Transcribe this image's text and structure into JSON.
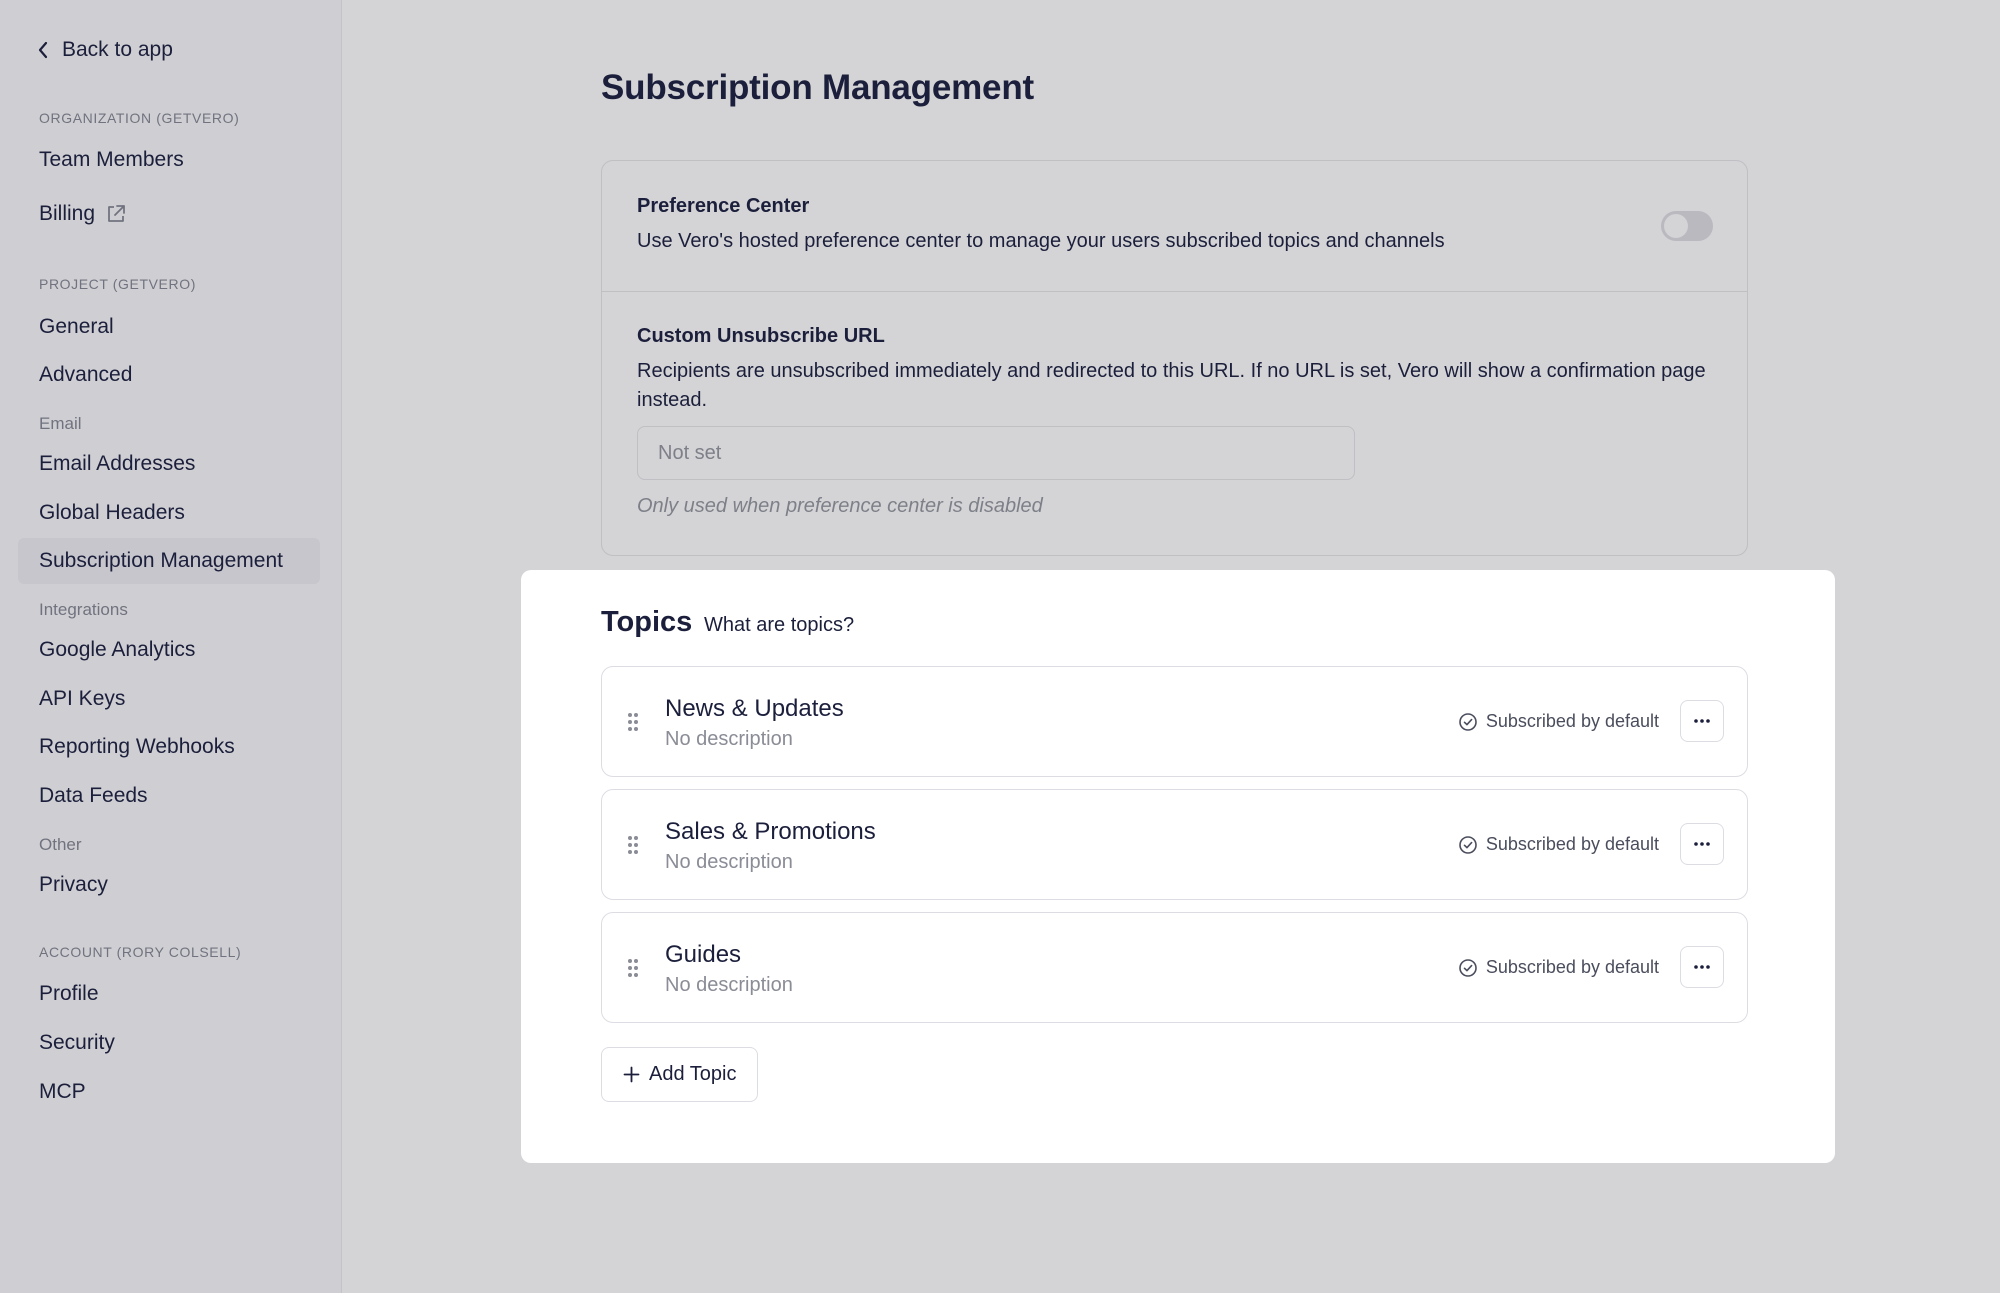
{
  "sidebar": {
    "back_label": "Back to app",
    "sections": {
      "organization": "ORGANIZATION (GETVERO)",
      "project": "PROJECT (GETVERO)",
      "account": "ACCOUNT (RORY COLSELL)"
    },
    "groups": {
      "email": "Email",
      "integrations": "Integrations",
      "other": "Other"
    },
    "items": {
      "team_members": "Team Members",
      "billing": "Billing",
      "general": "General",
      "advanced": "Advanced",
      "email_addresses": "Email Addresses",
      "global_headers": "Global Headers",
      "subscription_management": "Subscription Management",
      "google_analytics": "Google Analytics",
      "api_keys": "API Keys",
      "reporting_webhooks": "Reporting Webhooks",
      "data_feeds": "Data Feeds",
      "privacy": "Privacy",
      "profile": "Profile",
      "security": "Security",
      "mcp": "MCP"
    },
    "active_item": "Subscription Management"
  },
  "main": {
    "title": "Subscription Management",
    "preference_center": {
      "title": "Preference Center",
      "description": "Use Vero's hosted preference center to manage your users subscribed topics and channels",
      "enabled": false
    },
    "custom_unsubscribe": {
      "title": "Custom Unsubscribe URL",
      "description": "Recipients are unsubscribed immediately and redirected to this URL. If no URL is set, Vero will show a confirmation page instead.",
      "value": "",
      "placeholder": "Not set",
      "hint": "Only used when preference center is disabled"
    },
    "topics": {
      "title": "Topics",
      "help_link": "What are topics?",
      "items": [
        {
          "name": "News & Updates",
          "description": "No description",
          "status": "Subscribed by default"
        },
        {
          "name": "Sales & Promotions",
          "description": "No description",
          "status": "Subscribed by default"
        },
        {
          "name": "Guides",
          "description": "No description",
          "status": "Subscribed by default"
        }
      ],
      "add_label": "Add Topic"
    }
  },
  "icons": {
    "back": "chevron-left-icon",
    "external": "external-link-icon",
    "drag": "drag-handle-icon",
    "check": "check-circle-icon",
    "more": "ellipsis-icon",
    "add": "plus-icon"
  },
  "colors": {
    "text": "#1b1f3b",
    "muted": "#70737f",
    "overlay_bg": "#d4d4d6",
    "card_bg": "#ffffff",
    "border": "#dcdde3"
  }
}
